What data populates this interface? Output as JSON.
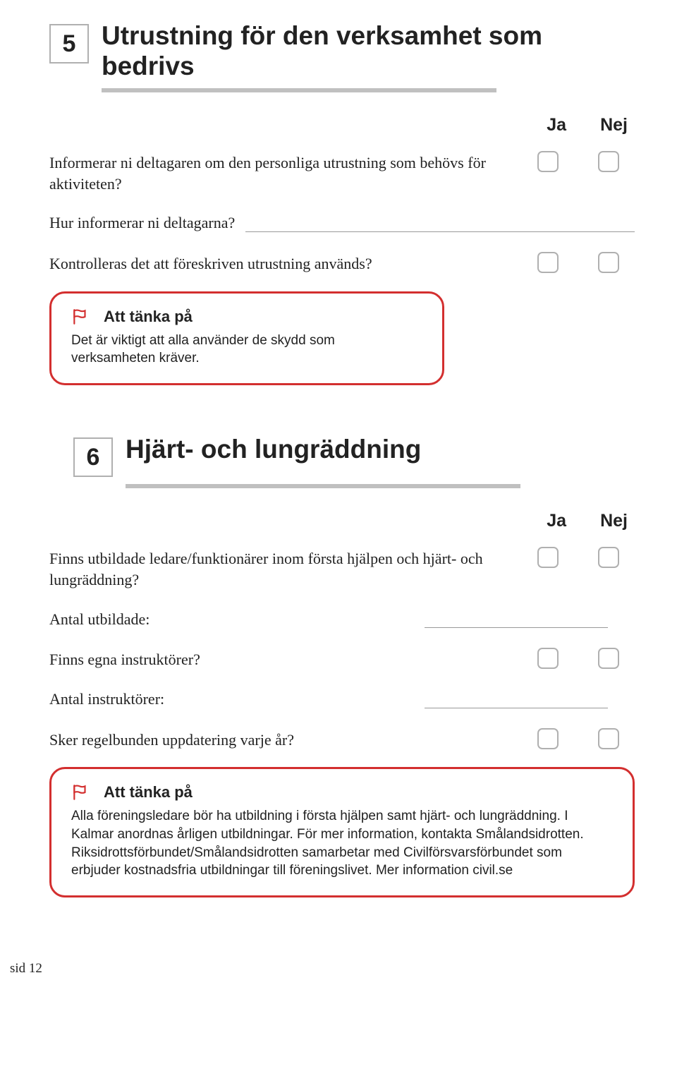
{
  "section5": {
    "number": "5",
    "title": "Utrustning för den verksamhet som bedrivs",
    "ja": "Ja",
    "nej": "Nej",
    "q1": "Informerar ni deltagaren om den personliga utrustning som behövs för aktiviteten?",
    "q2": "Hur informerar ni deltagarna?",
    "q3": "Kontrolleras det att föreskriven utrustning används?",
    "callout_title": "Att tänka på",
    "callout_body": "Det är viktigt att alla använder de skydd som verksamheten kräver."
  },
  "section6": {
    "number": "6",
    "title": "Hjärt- och lungräddning",
    "ja": "Ja",
    "nej": "Nej",
    "q1": "Finns utbildade ledare/funktionärer inom första hjälpen och hjärt- och lungräddning?",
    "q2": "Antal utbildade:",
    "q3": "Finns egna instruktörer?",
    "q4": "Antal instruktörer:",
    "q5": "Sker regelbunden uppdatering varje år?",
    "callout_title": "Att tänka på",
    "callout_body": "Alla föreningsledare bör ha utbildning i första hjälpen samt hjärt- och lungräddning. I Kalmar anordnas årligen utbildningar. För mer information, kontakta Smålandsidrotten. Riksidrottsförbundet/Smålandsidrotten samarbetar med Civilförsvarsförbundet som erbjuder kostnadsfria utbildningar till föreningslivet. Mer information civil.se"
  },
  "page": "sid 12"
}
